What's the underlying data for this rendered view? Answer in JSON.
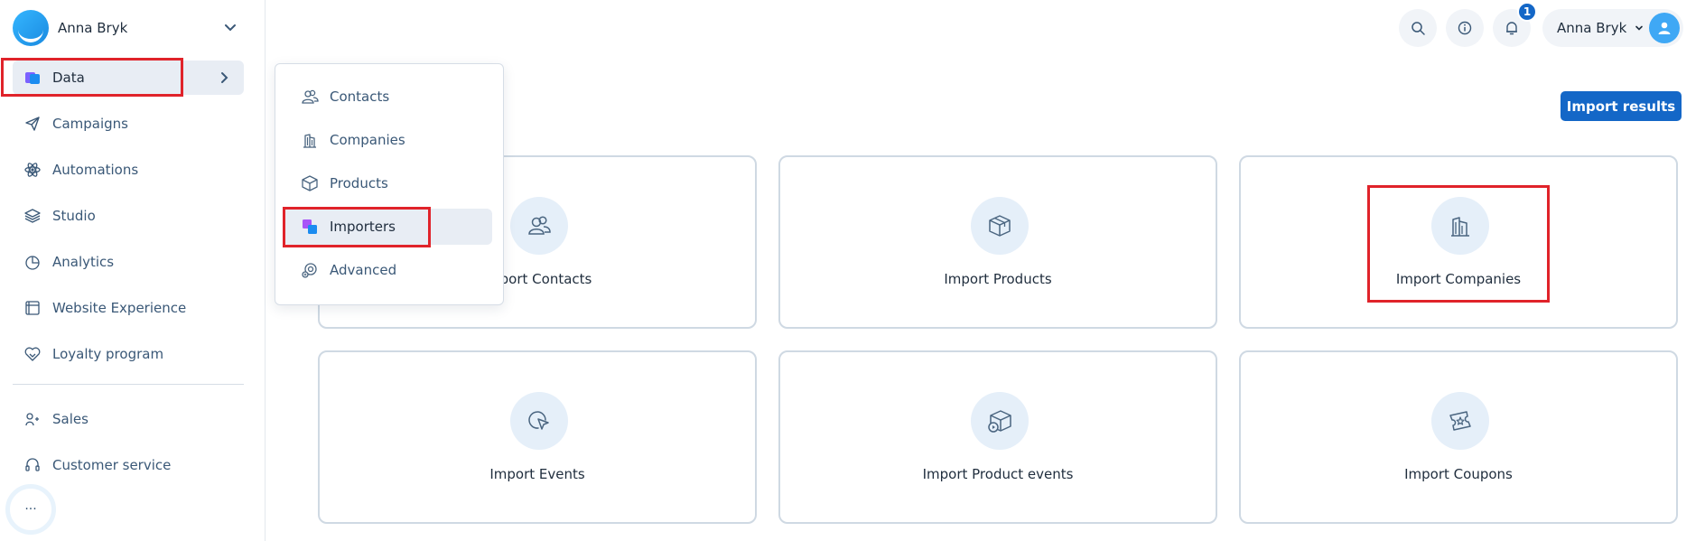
{
  "workspace": {
    "name": "Anna Bryk"
  },
  "sidebar": {
    "items": [
      {
        "label": "Data",
        "icon": "data-icon"
      },
      {
        "label": "Campaigns",
        "icon": "paper-plane-icon"
      },
      {
        "label": "Automations",
        "icon": "atom-icon"
      },
      {
        "label": "Studio",
        "icon": "layers-icon"
      },
      {
        "label": "Analytics",
        "icon": "pie-chart-icon"
      },
      {
        "label": "Website Experience",
        "icon": "browser-window-icon"
      },
      {
        "label": "Loyalty program",
        "icon": "heart-tag-icon"
      },
      {
        "label": "Sales",
        "icon": "sales-icon"
      },
      {
        "label": "Customer service",
        "icon": "headset-icon"
      }
    ],
    "more_label": "···"
  },
  "header": {
    "notifications_count": "1",
    "user_name": "Anna Bryk"
  },
  "data_menu": {
    "items": [
      {
        "label": "Contacts",
        "icon": "contacts-icon"
      },
      {
        "label": "Companies",
        "icon": "building-icon"
      },
      {
        "label": "Products",
        "icon": "box-icon"
      },
      {
        "label": "Importers",
        "icon": "importers-icon"
      },
      {
        "label": "Advanced",
        "icon": "advanced-icon"
      }
    ]
  },
  "main": {
    "import_results_label": "Import results",
    "cards": [
      {
        "label": "Import Contacts",
        "icon": "contacts-icon"
      },
      {
        "label": "Import Products",
        "icon": "box-icon"
      },
      {
        "label": "Import Companies",
        "icon": "building-icon"
      },
      {
        "label": "Import Events",
        "icon": "cursor-click-icon"
      },
      {
        "label": "Import Product events",
        "icon": "box-play-icon"
      },
      {
        "label": "Import Coupons",
        "icon": "coupon-icon"
      }
    ]
  },
  "colors": {
    "accent": "#1467c7",
    "highlight": "#e0232a",
    "icon_bg": "#e5eff9",
    "nav_text": "#3a5877"
  }
}
